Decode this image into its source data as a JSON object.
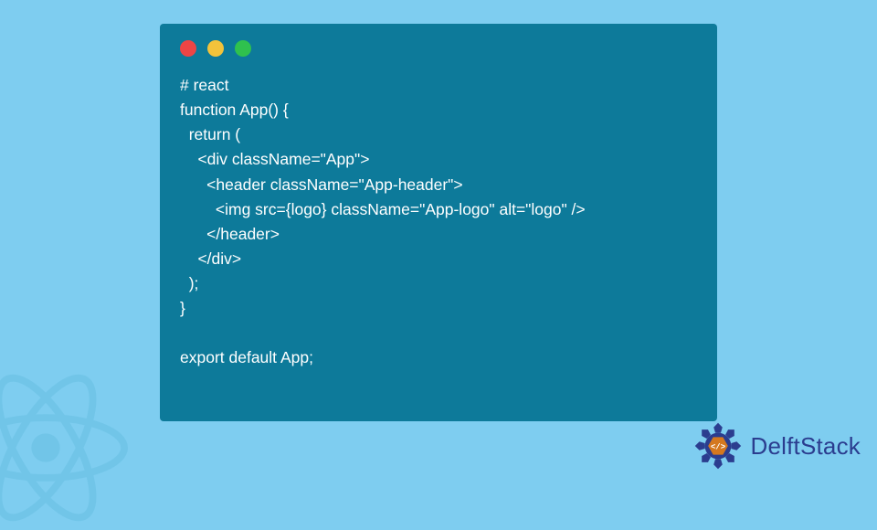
{
  "window": {
    "traffic_lights": [
      "red",
      "yellow",
      "green"
    ]
  },
  "code": {
    "lines": [
      "# react",
      "function App() {",
      "  return (",
      "    <div className=\"App\">",
      "      <header className=\"App-header\">",
      "        <img src={logo} className=\"App-logo\" alt=\"logo\" />",
      "      </header>",
      "    </div>",
      "  );",
      "}",
      "",
      "export default App;"
    ]
  },
  "brand": {
    "name": "DelftStack"
  },
  "decor": {
    "react_icon": "react-logo-icon"
  },
  "colors": {
    "background": "#7ecdf0",
    "window_bg": "#0d7a9a",
    "code_text": "#ffffff",
    "brand_text": "#2b3d8f"
  }
}
